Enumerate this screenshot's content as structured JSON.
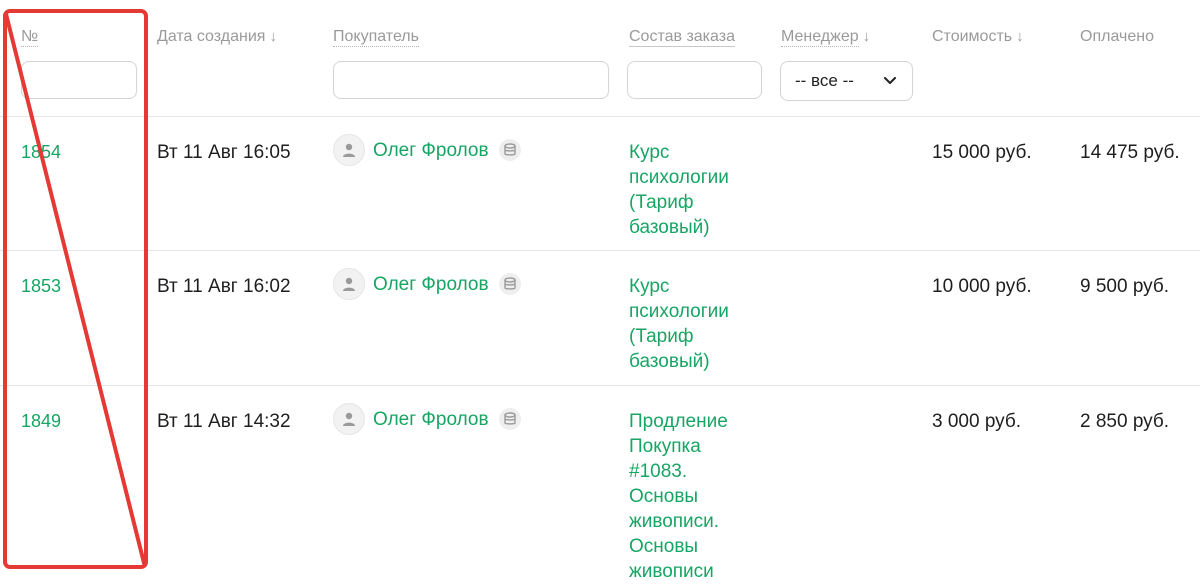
{
  "columns": {
    "number": "№",
    "created": "Дата создания",
    "buyer": "Покупатель",
    "composition": "Состав заказа",
    "manager": "Менеджер",
    "cost": "Стоимость",
    "paid": "Оплачено",
    "sort_arrow": "↓"
  },
  "filters": {
    "number_value": "",
    "buyer_value": "",
    "composition_value": "",
    "manager_selected": "-- все --"
  },
  "orders": [
    {
      "id": "1854",
      "date": "Вт 11 Авг 16:05",
      "buyer": "Олег Фролов",
      "product_lines": [
        "Курс",
        "психологии",
        "(Тариф",
        "базовый)"
      ],
      "cost": "15 000 руб.",
      "paid": "14 475 руб."
    },
    {
      "id": "1853",
      "date": "Вт 11 Авг 16:02",
      "buyer": "Олег Фролов",
      "product_lines": [
        "Курс",
        "психологии",
        "(Тариф",
        "базовый)"
      ],
      "cost": "10 000 руб.",
      "paid": "9 500 руб."
    },
    {
      "id": "1849",
      "date": "Вт 11 Авг 14:32",
      "buyer": "Олег Фролов",
      "product_lines": [
        "Продление",
        "Покупка",
        "#1083.",
        "Основы",
        "живописи.",
        "Основы",
        "живописи"
      ],
      "cost": "3 000 руб.",
      "paid": "2 850 руб."
    }
  ],
  "icons": {
    "avatar": "user-avatar-icon",
    "db": "database-icon",
    "dropdown": "chevron-down-icon"
  },
  "colors": {
    "link": "#17a564",
    "annotation": "#e53935"
  }
}
